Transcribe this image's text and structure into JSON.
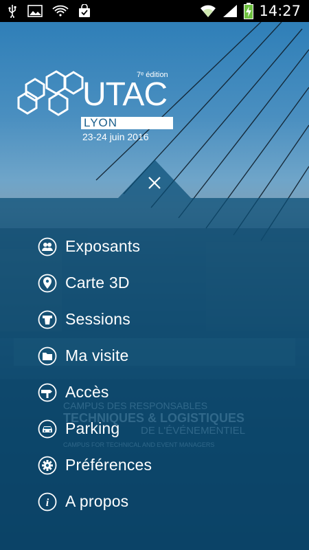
{
  "status_bar": {
    "time": "14:27"
  },
  "logo": {
    "edition": "7ᵉ édition",
    "name": "UTAC",
    "city": "LYON",
    "dates": "23-24 juin 2016"
  },
  "menu": {
    "items": [
      {
        "label": "Exposants",
        "icon": "people-icon"
      },
      {
        "label": "Carte 3D",
        "icon": "map-pin-icon"
      },
      {
        "label": "Sessions",
        "icon": "podium-icon"
      },
      {
        "label": "Ma visite",
        "icon": "folder-icon"
      },
      {
        "label": "Accès",
        "icon": "signpost-icon"
      },
      {
        "label": "Parking",
        "icon": "car-icon"
      },
      {
        "label": "Préférences",
        "icon": "gear-icon"
      },
      {
        "label": "A propos",
        "icon": "info-icon"
      }
    ]
  },
  "background_text": {
    "line1": "CAMPUS DES RESPONSABLES",
    "line2": "TECHNIQUES & LOGISTIQUES",
    "line3": "DE L'ÉVÉNEMENTIEL",
    "line4": "CAMPUS FOR TECHNICAL AND EVENT MANAGERS"
  },
  "colors": {
    "overlay": "#0a4e76",
    "text": "#ffffff",
    "accent": "#1b5f8c"
  }
}
